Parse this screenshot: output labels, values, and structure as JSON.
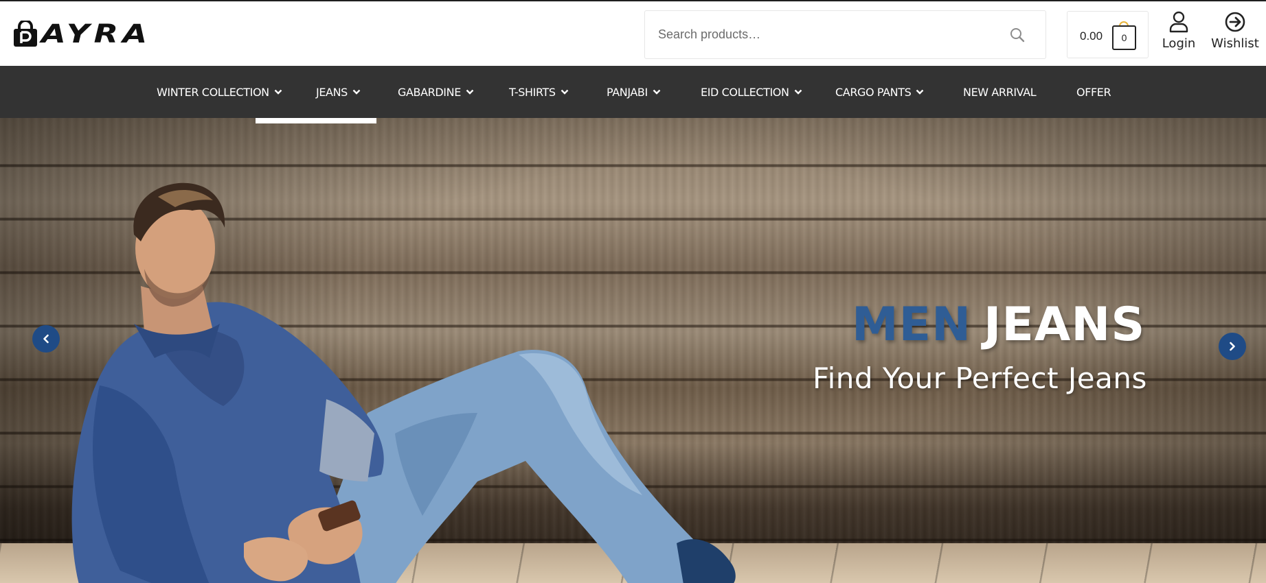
{
  "header": {
    "logo_text": "AYRA",
    "search": {
      "placeholder": "Search products…",
      "value": ""
    },
    "cart": {
      "amount": "0.00",
      "count": "0"
    },
    "login_label": "Login",
    "wishlist_label": "Wishlist"
  },
  "nav": {
    "items": [
      {
        "label": "WINTER COLLECTION",
        "has_dropdown": true
      },
      {
        "label": "JEANS",
        "has_dropdown": true
      },
      {
        "label": "GABARDINE",
        "has_dropdown": true
      },
      {
        "label": "T-SHIRTS",
        "has_dropdown": true
      },
      {
        "label": "PANJABI",
        "has_dropdown": true
      },
      {
        "label": "EID COLLECTION",
        "has_dropdown": true
      },
      {
        "label": "CARGO PANTS",
        "has_dropdown": true
      },
      {
        "label": "NEW ARRIVAL",
        "has_dropdown": false
      },
      {
        "label": "OFFER",
        "has_dropdown": false
      }
    ]
  },
  "hero": {
    "headline_accent": "MEN",
    "headline_main": "JEANS",
    "subheadline": "Find Your Perfect Jeans",
    "prev_icon": "chevron-left-icon",
    "next_icon": "chevron-right-icon"
  },
  "colors": {
    "nav_background": "#333333",
    "accent_blue": "#2f5d95",
    "slider_button": "#1f4b86",
    "cart_handle": "#e8b43a"
  }
}
